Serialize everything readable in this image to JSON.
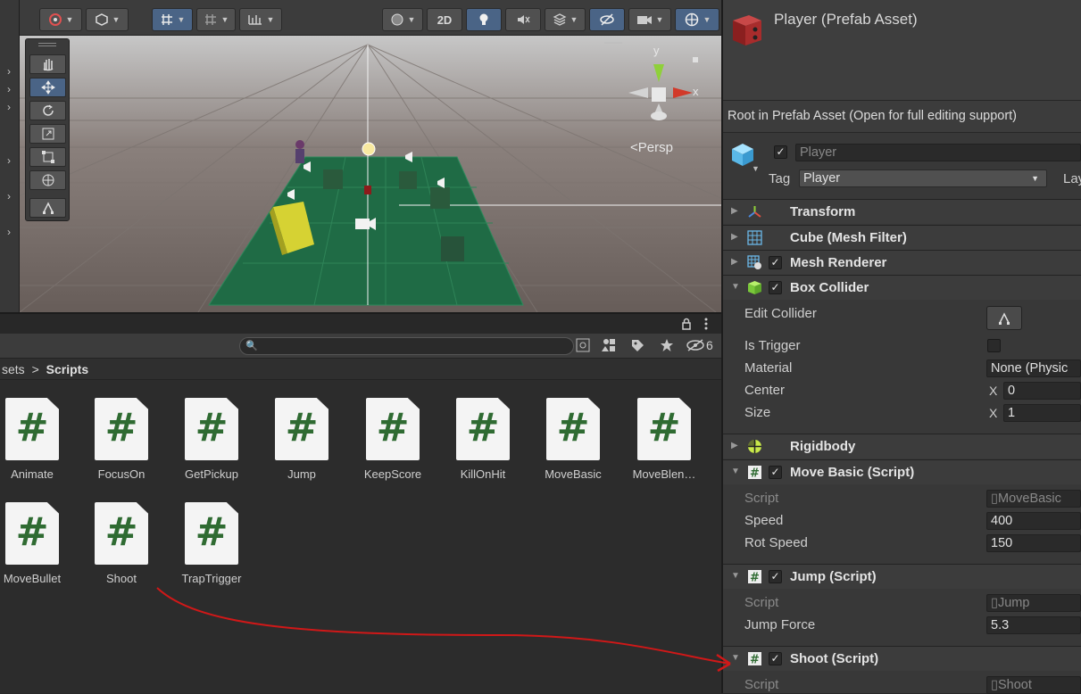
{
  "scene": {
    "toolbar": {
      "two_d_label": "2D"
    },
    "persp_label": "<Persp",
    "gizmo": {
      "y_label": "y",
      "x_label": "x"
    }
  },
  "project": {
    "search": {
      "placeholder": ""
    },
    "hidden_count": "6",
    "breadcrumb": {
      "parent": "sets",
      "sep": ">",
      "current": "Scripts"
    },
    "assets": [
      {
        "name": "Animate"
      },
      {
        "name": "FocusOn"
      },
      {
        "name": "GetPickup"
      },
      {
        "name": "Jump"
      },
      {
        "name": "KeepScore"
      },
      {
        "name": "KillOnHit"
      },
      {
        "name": "MoveBasic"
      },
      {
        "name": "MoveBlen…"
      },
      {
        "name": "MoveBullet"
      },
      {
        "name": "Shoot"
      },
      {
        "name": "TrapTrigger"
      }
    ],
    "script_glyph": "#"
  },
  "inspector": {
    "title": "Player (Prefab Asset)",
    "root_notice": "Root in Prefab Asset (Open for full editing support)",
    "object_name": "Player",
    "tag_label": "Tag",
    "tag_value": "Player",
    "layer_label": "Lay",
    "components": {
      "transform": "Transform",
      "mesh_filter": "Cube (Mesh Filter)",
      "mesh_renderer": "Mesh Renderer",
      "box_collider": "Box Collider",
      "rigidbody": "Rigidbody",
      "move_basic": "Move Basic (Script)",
      "jump": "Jump (Script)",
      "shoot": "Shoot (Script)"
    },
    "box_collider": {
      "edit_label": "Edit Collider",
      "is_trigger_label": "Is Trigger",
      "material_label": "Material",
      "material_value": "None (Physic",
      "center_label": "Center",
      "center_x_label": "X",
      "center_x": "0",
      "size_label": "Size",
      "size_x_label": "X",
      "size_x": "1"
    },
    "move_basic": {
      "script_label": "Script",
      "script_value": "MoveBasic",
      "speed_label": "Speed",
      "speed_value": "400",
      "rot_label": "Rot Speed",
      "rot_value": "150"
    },
    "jump": {
      "script_label": "Script",
      "script_value": "Jump",
      "force_label": "Jump Force",
      "force_value": "5.3"
    },
    "shoot": {
      "script_label": "Script",
      "script_value": "Shoot"
    }
  },
  "colors": {
    "accent": "#4a6486",
    "ground": "#1f6b45",
    "annotation_arrow": "#d01818",
    "script_hash": "#2f6b32"
  }
}
